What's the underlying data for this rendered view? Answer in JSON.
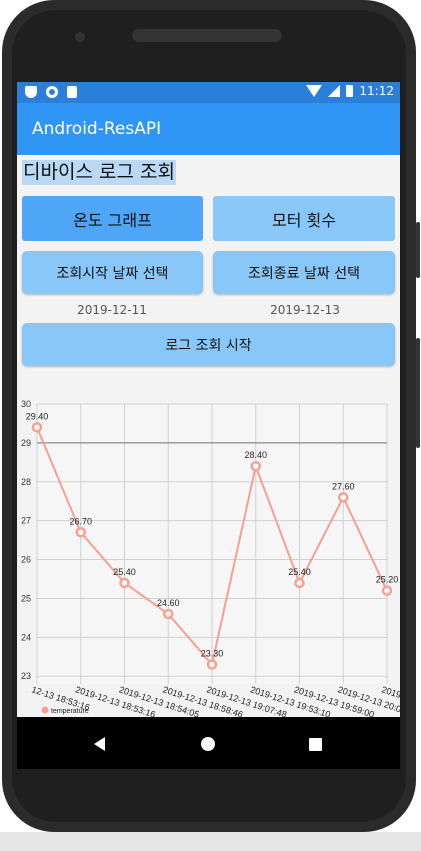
{
  "status_bar": {
    "time": "11:12",
    "left_icons": [
      "shield-icon",
      "record-icon",
      "sd-card-icon"
    ],
    "right_icons": [
      "wifi-icon",
      "signal-icon",
      "battery-icon"
    ]
  },
  "app_bar": {
    "title": "Android-ResAPI"
  },
  "page": {
    "title": "디바이스 로그 조회"
  },
  "tabs": [
    {
      "label": "온도 그래프",
      "active": true
    },
    {
      "label": "모터 횟수",
      "active": false
    }
  ],
  "date_buttons": {
    "start_label": "조회시작 날짜 선택",
    "end_label": "조회종료 날짜 선택",
    "start_date": "2019-12-11",
    "end_date": "2019-12-13"
  },
  "query_button": {
    "label": "로그 조회 시작"
  },
  "colors": {
    "status_bar": "#2a7fd9",
    "app_bar": "#2f96f5",
    "tab_active": "#4fa6f7",
    "button": "#88c7f8",
    "series": "#f7a08e"
  },
  "chart_data": {
    "type": "line",
    "ylim": [
      22.8,
      30
    ],
    "y_ticks": [
      "30",
      "29",
      "28",
      "27",
      "26",
      "25",
      "24",
      "23"
    ],
    "limit_line": 29,
    "x": [
      "2019-12-13 18:53:16",
      "2019-12-13 18:53:16",
      "2019-12-13 18:54:05",
      "2019-12-13 18:58:46",
      "2019-12-13 19:07:48",
      "2019-12-13 19:53:10",
      "2019-12-13 19:59:00",
      "2019-12-13 20:01:40",
      "2019-12-13 20:04:50"
    ],
    "x_tick_labels": [
      "12-13 18:53:16",
      "2019-12-13 18:53:16",
      "2019-12-13 18:54:05",
      "2019-12-13 18:58:46",
      "2019-12-13 19:07:48",
      "2019-12-13 19:53:10",
      "2019-12-13 19:59:00",
      "2019-12-13 20:01:40",
      "2019-12-13 20:04:50"
    ],
    "series": [
      {
        "name": "temperature",
        "values": [
          29.4,
          26.7,
          25.4,
          24.6,
          23.3,
          28.4,
          25.4,
          27.6,
          25.2
        ]
      }
    ],
    "data_labels": [
      "29.40",
      "26.70",
      "25.40",
      "24.60",
      "23.30",
      "28.40",
      "25.40",
      "27.60",
      "25.20"
    ],
    "grid": true,
    "legend": "bottom-left"
  }
}
